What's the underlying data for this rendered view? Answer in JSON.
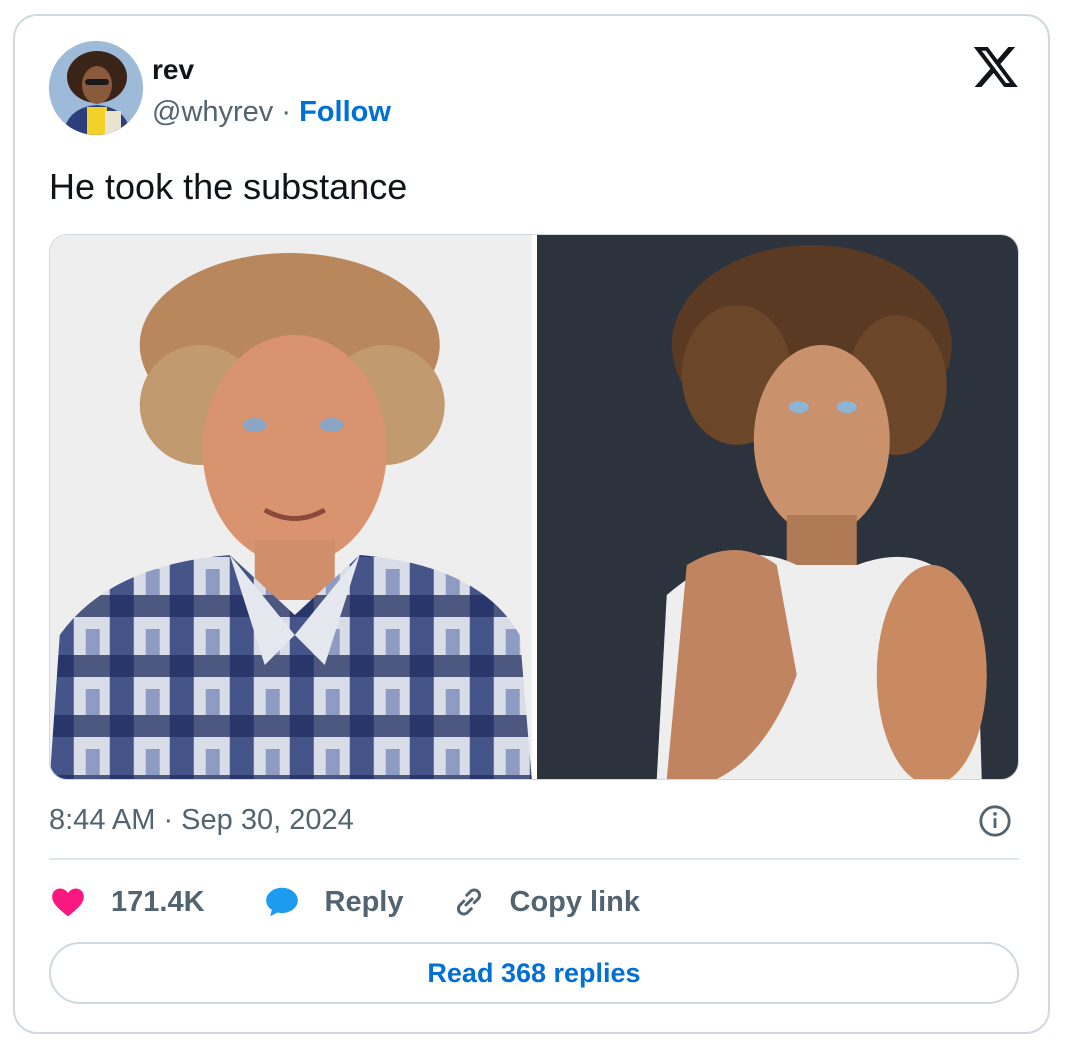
{
  "author": {
    "display_name": "rev",
    "handle": "@whyrev",
    "separator": "·",
    "follow_label": "Follow",
    "avatar": "profile-photo"
  },
  "brand": {
    "logo": "x-logo-icon"
  },
  "tweet": {
    "text": "He took the substance",
    "media": [
      {
        "name": "photo-left",
        "description_icon": "portrait-plaid-shirt"
      },
      {
        "name": "photo-right",
        "description_icon": "portrait-white-tank"
      }
    ],
    "timestamp": "8:44 AM · Sep 30, 2024"
  },
  "actions": {
    "like_count": "171.4K",
    "reply_label": "Reply",
    "copy_label": "Copy link"
  },
  "footer": {
    "read_replies_label": "Read 368 replies"
  },
  "colors": {
    "accent": "#006fd6",
    "like": "#f91880",
    "reply_icon": "#1d9bf0",
    "muted_text": "#536471",
    "border": "#cfd9de"
  }
}
